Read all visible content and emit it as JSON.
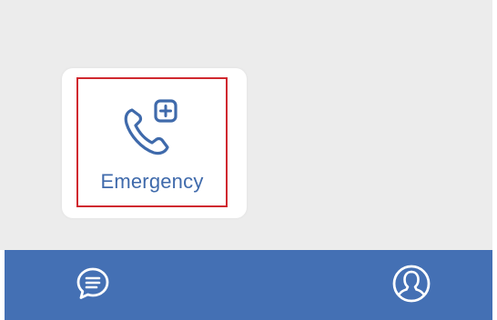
{
  "card": {
    "label": "Emergency",
    "icon": "phone-plus-icon",
    "label_color": "#3f6aab",
    "highlight_border_color": "#d0282f"
  },
  "bottom_nav": {
    "background": "#4470b4",
    "items": [
      {
        "icon": "chat-bubble-icon"
      },
      {
        "icon": "profile-avatar-icon"
      }
    ]
  },
  "colors": {
    "content_background": "#ececec",
    "card_background": "#ffffff",
    "icon_white": "#ffffff"
  }
}
